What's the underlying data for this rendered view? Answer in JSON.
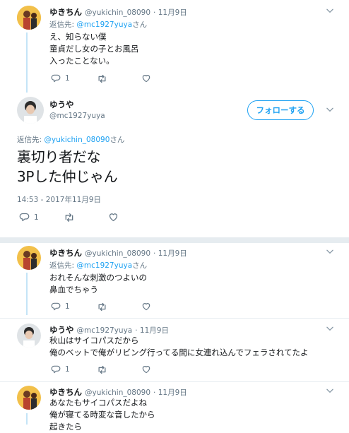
{
  "colors": {
    "accent": "#1da1f2",
    "thread": "#c4e4f7",
    "muted": "#657786",
    "border": "#e6ecf0"
  },
  "reply_prefix": "返信先: ",
  "reply_suffix": "さん",
  "tweet1": {
    "name": "ゆきちん",
    "handle": "@yukichin_08090",
    "date": "· 11月9日",
    "reply_to": "@mc1927yuya",
    "lines": [
      "え、知らない僕",
      "童貞だし女の子とお風呂",
      "入ったことない。"
    ],
    "reply_count": "1"
  },
  "main": {
    "name": "ゆうや",
    "handle": "@mc1927yuya",
    "follow_label": "フォローする",
    "reply_to": "@yukichin_08090",
    "lines": [
      "裏切り者だな",
      "3Pした仲じゃん"
    ],
    "timestamp": "14:53 - 2017年11月9日",
    "reply_count": "1"
  },
  "reply1": {
    "name": "ゆきちん",
    "handle": "@yukichin_08090",
    "date": "· 11月9日",
    "reply_to": "@mc1927yuya",
    "lines": [
      "おれそんな刺激のつよいの",
      "鼻血でちゃう"
    ],
    "reply_count": "1"
  },
  "reply2": {
    "name": "ゆうや",
    "handle": "@mc1927yuya",
    "date": "· 11月9日",
    "lines": [
      "秋山はサイコパスだから",
      "俺のベットで俺がリビング行ってる間に女連れ込んでフェラされてたよ"
    ],
    "reply_count": "1"
  },
  "reply3": {
    "name": "ゆきちん",
    "handle": "@yukichin_08090",
    "date": "· 11月9日",
    "lines": [
      "あなたもサイコパスだよね",
      "俺が寝てる時変な音したから",
      "起きたら"
    ]
  },
  "icons": [
    "reply-icon",
    "retweet-icon",
    "like-icon",
    "chevron-down-icon"
  ]
}
